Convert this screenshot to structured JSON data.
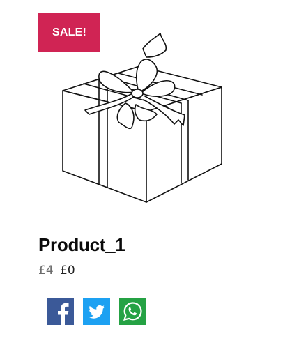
{
  "product": {
    "badge": "SALE!",
    "title": "Product_1",
    "price_old": "£4",
    "price_new": "£0",
    "image_icon": "gift-box-illustration",
    "badge_color": "#d02454"
  },
  "share": [
    {
      "network": "Facebook",
      "icon": "facebook-icon",
      "color": "#3b5998"
    },
    {
      "network": "Twitter",
      "icon": "twitter-icon",
      "color": "#1da1f2"
    },
    {
      "network": "WhatsApp",
      "icon": "whatsapp-icon",
      "color": "#25a244"
    }
  ]
}
